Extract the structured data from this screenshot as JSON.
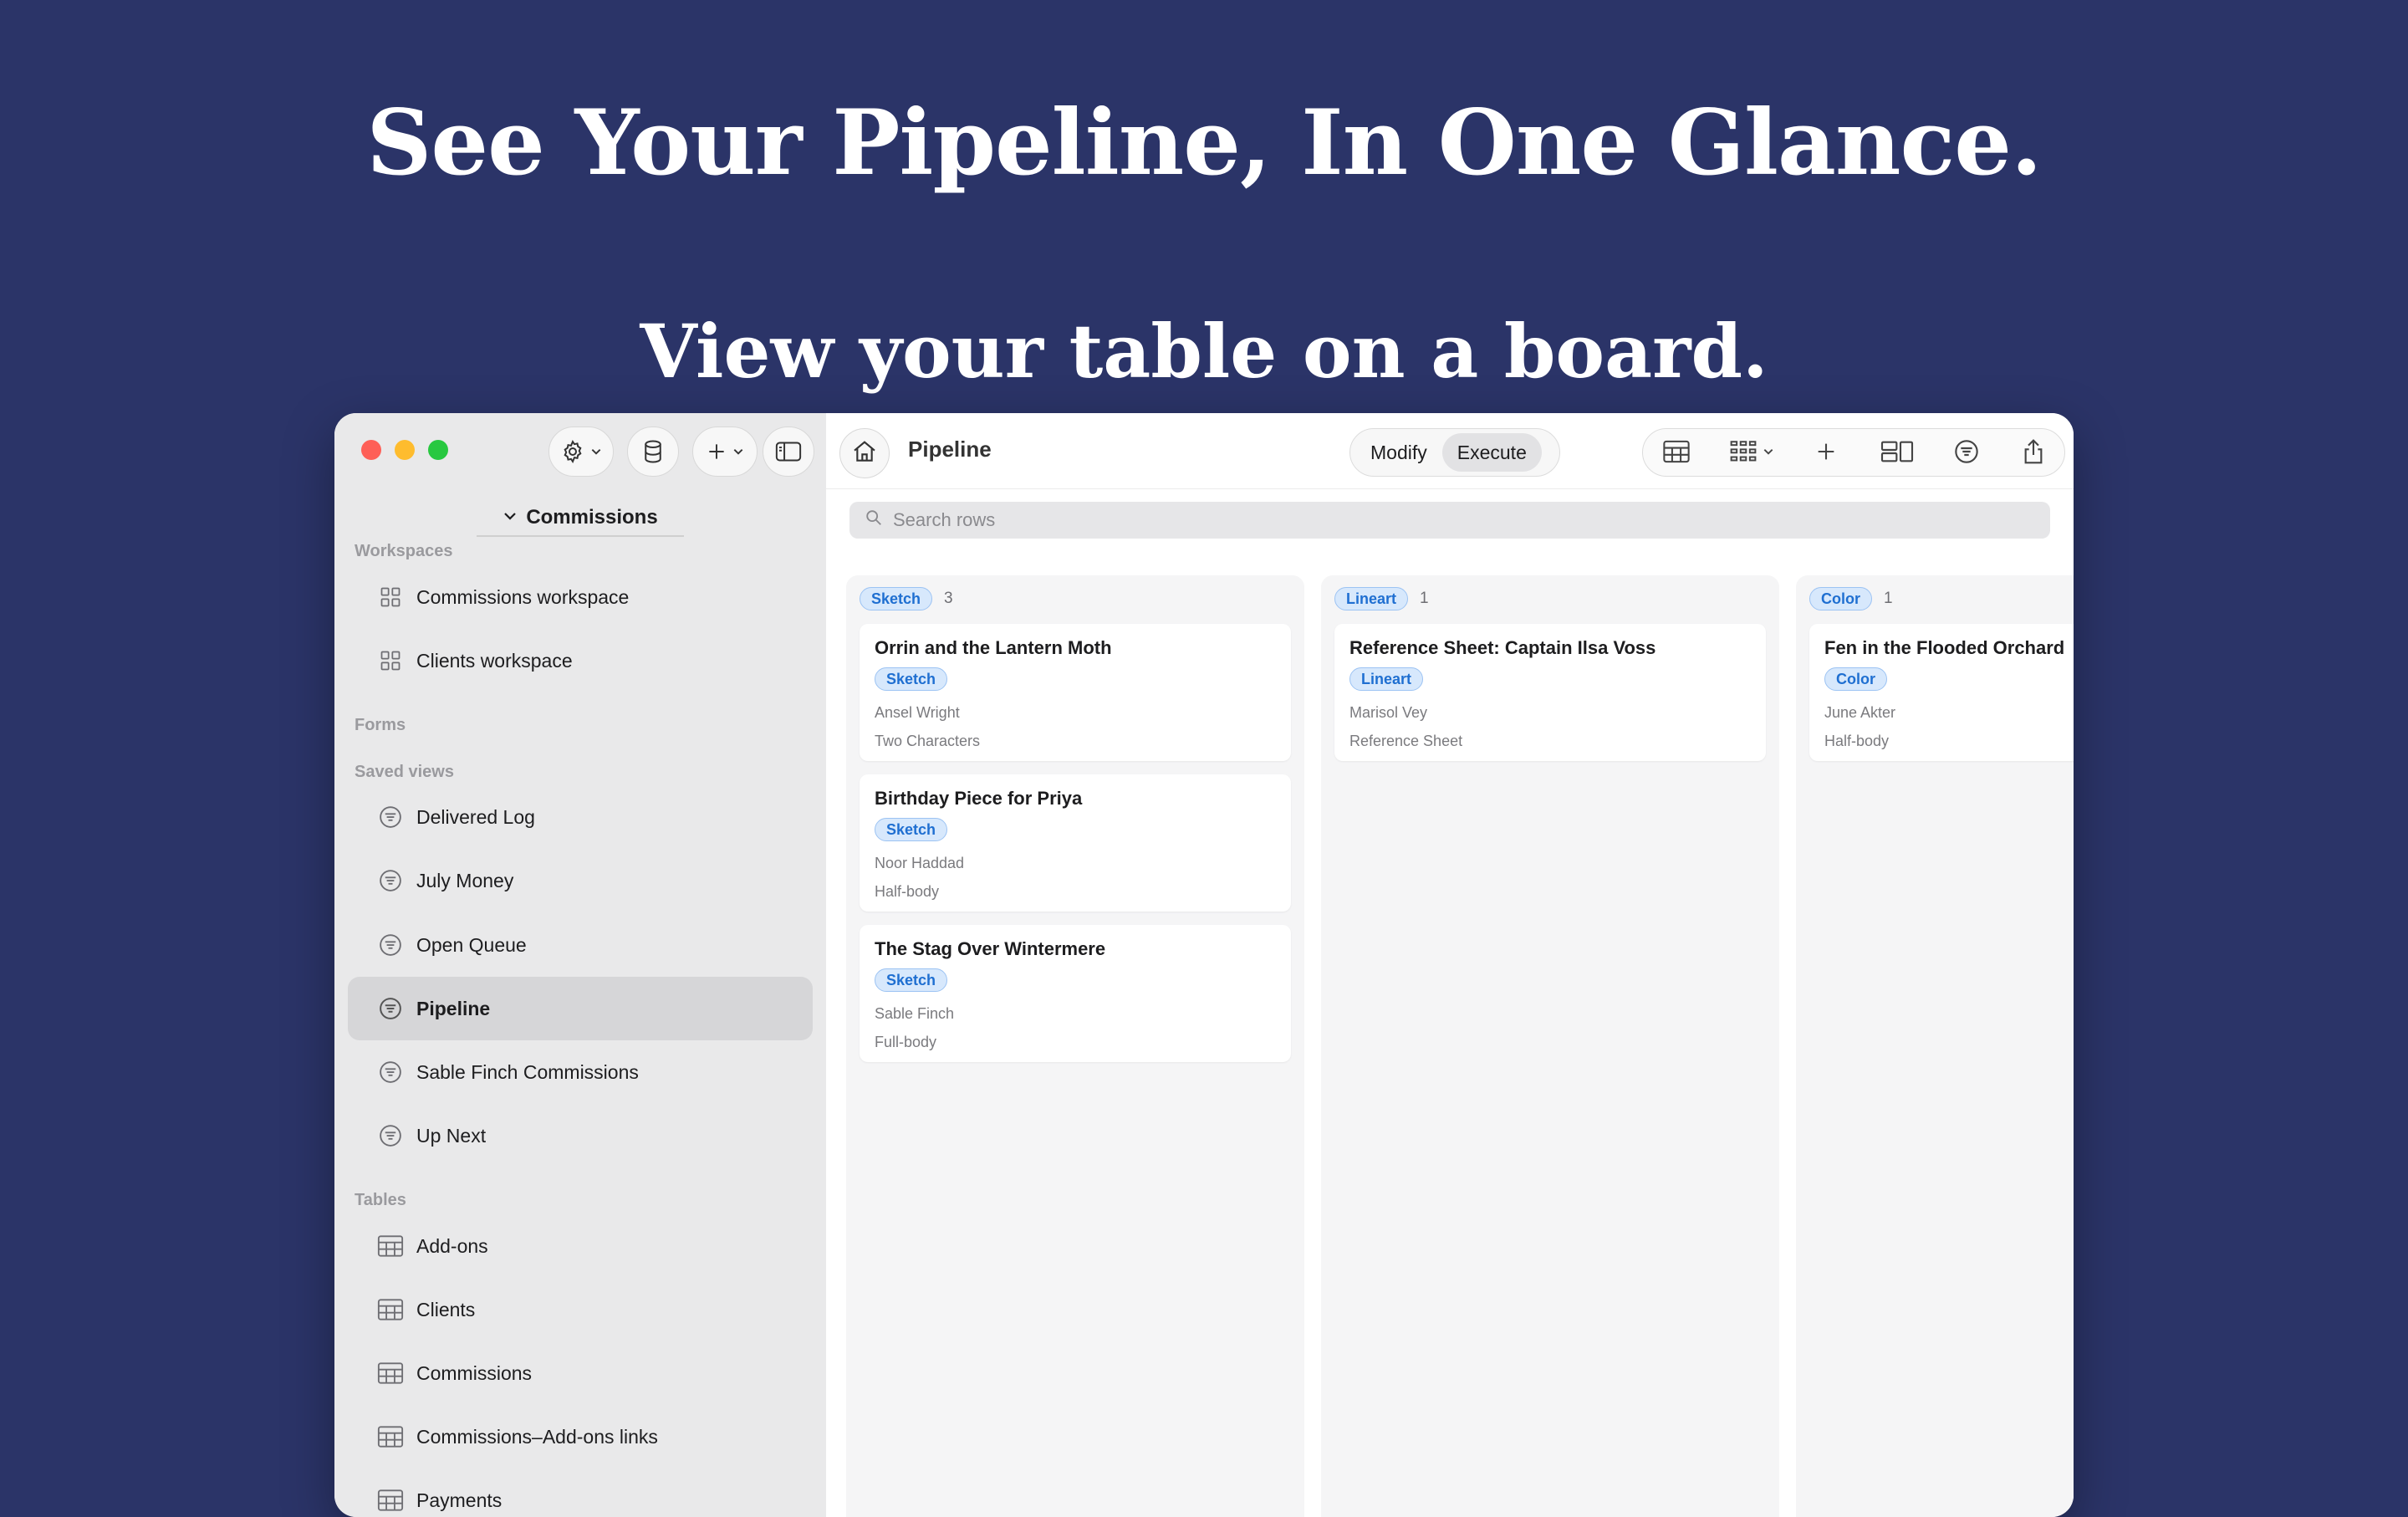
{
  "headline": "See Your Pipeline, In One Glance.",
  "subheadline": "View your table on a board.",
  "sidebar": {
    "workspace_selector": "Commissions",
    "sections": {
      "workspaces": "Workspaces",
      "forms": "Forms",
      "saved_views": "Saved views",
      "tables": "Tables"
    },
    "workspaces": [
      "Commissions workspace",
      "Clients workspace"
    ],
    "saved_views": [
      "Delivered Log",
      "July Money",
      "Open Queue",
      "Pipeline",
      "Sable Finch Commissions",
      "Up Next"
    ],
    "active_view": "Pipeline",
    "tables": [
      "Add-ons",
      "Clients",
      "Commissions",
      "Commissions–Add-ons links",
      "Payments"
    ]
  },
  "toolbar": {
    "title": "Pipeline",
    "modify_label": "Modify",
    "execute_label": "Execute",
    "selected_mode": "Execute"
  },
  "search": {
    "placeholder": "Search rows"
  },
  "board": {
    "columns": [
      {
        "label": "Sketch",
        "count": "3",
        "cards": [
          {
            "title": "Orrin and the Lantern Moth",
            "tag": "Sketch",
            "client": "Ansel Wright",
            "type": "Two Characters"
          },
          {
            "title": "Birthday Piece for Priya",
            "tag": "Sketch",
            "client": "Noor Haddad",
            "type": "Half-body"
          },
          {
            "title": "The Stag Over Wintermere",
            "tag": "Sketch",
            "client": "Sable Finch",
            "type": "Full-body"
          }
        ]
      },
      {
        "label": "Lineart",
        "count": "1",
        "cards": [
          {
            "title": "Reference Sheet: Captain Ilsa Voss",
            "tag": "Lineart",
            "client": "Marisol Vey",
            "type": "Reference Sheet"
          }
        ]
      },
      {
        "label": "Color",
        "count": "1",
        "cards": [
          {
            "title": "Fen in the Flooded Orchard",
            "tag": "Color",
            "client": "June Akter",
            "type": "Half-body"
          }
        ]
      }
    ]
  },
  "colors": {
    "background": "#2b3468",
    "badge_text": "#1f6fd1",
    "badge_bg": "#d7e8fc"
  },
  "icons": {
    "sidebar_toolbar": [
      "gear-icon",
      "database-icon",
      "plus-icon",
      "sidebar-toggle-icon"
    ],
    "main_toolbar": [
      "home-icon",
      "table-view-icon",
      "board-view-icon",
      "add-icon",
      "layout-icon",
      "filter-icon",
      "share-icon"
    ]
  }
}
